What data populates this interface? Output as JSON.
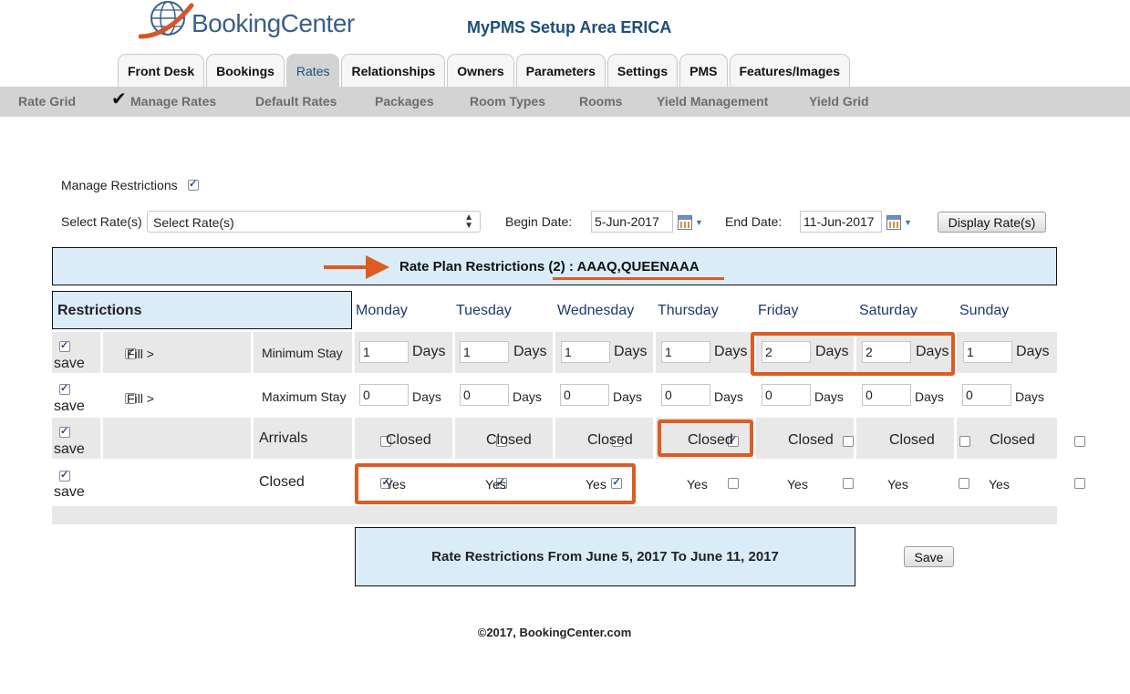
{
  "app": {
    "logo_text": "BookingCenter",
    "title": "MyPMS Setup Area ERICA"
  },
  "tabs": [
    {
      "label": "Front Desk"
    },
    {
      "label": "Bookings"
    },
    {
      "label": "Rates",
      "active": true
    },
    {
      "label": "Relationships"
    },
    {
      "label": "Owners"
    },
    {
      "label": "Parameters"
    },
    {
      "label": "Settings"
    },
    {
      "label": "PMS"
    },
    {
      "label": "Features/Images"
    }
  ],
  "subnav": [
    {
      "label": "Rate Grid"
    },
    {
      "label": "Manage Rates",
      "active": true
    },
    {
      "label": "Default Rates"
    },
    {
      "label": "Packages"
    },
    {
      "label": "Room Types"
    },
    {
      "label": "Rooms"
    },
    {
      "label": "Yield Management"
    },
    {
      "label": "Yield Grid"
    }
  ],
  "form": {
    "manage_restrictions_label": "Manage Restrictions",
    "manage_restrictions_checked": true,
    "select_rates_label": "Select Rate(s)",
    "select_rates_value": "Select Rate(s)",
    "begin_date_label": "Begin Date:",
    "begin_date_value": "5-Jun-2017",
    "end_date_label": "End Date:",
    "end_date_value": "11-Jun-2017",
    "display_button": "Display Rate(s)"
  },
  "banner": {
    "text": "Rate Plan Restrictions (2) : AAAQ,QUEENAAA"
  },
  "grid": {
    "header": "Restrictions",
    "days": [
      "Monday",
      "Tuesday",
      "Wednesday",
      "Thursday",
      "Friday",
      "Saturday",
      "Sunday"
    ],
    "save_label": "save",
    "fill_label": "Fill >",
    "days_unit": "Days",
    "rows": {
      "min_stay": {
        "label": "Minimum Stay",
        "fill_checked": true,
        "values": [
          "1",
          "1",
          "1",
          "1",
          "2",
          "2",
          "1"
        ]
      },
      "max_stay": {
        "label": "Maximum Stay",
        "fill_checked": false,
        "values": [
          "0",
          "0",
          "0",
          "0",
          "0",
          "0",
          "0"
        ]
      },
      "arrivals": {
        "label": "Arrivals",
        "option_label": "Closed",
        "checked": [
          false,
          false,
          false,
          true,
          false,
          false,
          false
        ]
      },
      "closed": {
        "label": "Closed",
        "option_label": "Yes",
        "checked": [
          true,
          true,
          true,
          false,
          false,
          false,
          false
        ]
      }
    }
  },
  "summary": {
    "text": "Rate Restrictions From June 5, 2017 To June 11, 2017",
    "save_button": "Save"
  },
  "footer": {
    "copyright": "©2017, BookingCenter.com"
  },
  "colors": {
    "accent": "#de5b22",
    "light_blue": "#d9ecf8",
    "title_blue": "#1c4e7a"
  }
}
